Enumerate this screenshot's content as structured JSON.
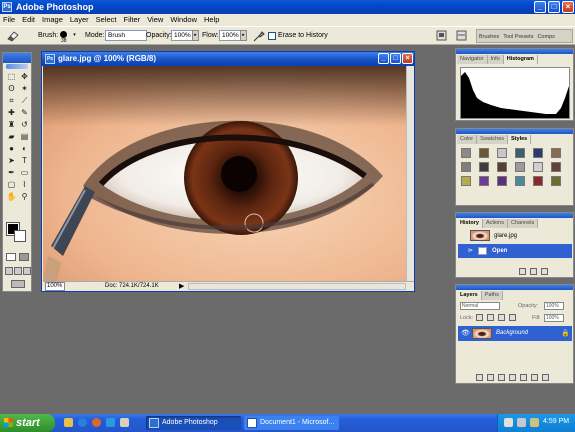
{
  "app": {
    "title": "Adobe Photoshop",
    "logo_text": "Ps"
  },
  "window_controls": {
    "minimize": "_",
    "maximize": "□",
    "close": "×"
  },
  "menu": [
    "File",
    "Edit",
    "Image",
    "Layer",
    "Select",
    "Filter",
    "View",
    "Window",
    "Help"
  ],
  "options_bar": {
    "brush_label": "Brush:",
    "brush_size": "38",
    "mode_label": "Mode:",
    "mode_value": "Brush",
    "opacity_label": "Opacity:",
    "opacity_value": "100%",
    "flow_label": "Flow:",
    "flow_value": "100%",
    "erase_to_history_label": "Erase to History",
    "palette_well_tabs": [
      "Brushes",
      "Tool Presets",
      "Comps"
    ]
  },
  "document": {
    "title": "glare.jpg @ 100% (RGB/8)",
    "zoom": "100%",
    "doc_info": "Doc: 724.1K/724.1K"
  },
  "navigator_palette": {
    "tabs": [
      "Navigator",
      "Info",
      "Histogram"
    ],
    "active_tab": "Histogram"
  },
  "color_palette": {
    "tabs": [
      "Color",
      "Swatches",
      "Styles"
    ],
    "active_tab": "Styles",
    "swatches": [
      "#8a8a8a",
      "#6b5a3a",
      "#c7c7c7",
      "#3b5d6e",
      "#2a3c6d",
      "#8d6a4f",
      "#7f7f7f",
      "#3d3d3d",
      "#5a3f2e",
      "#9b9b9b",
      "#cfcfcf",
      "#66403a",
      "#b3ad4a",
      "#6e3a9a",
      "#5b2f7c",
      "#4a8a9a",
      "#8a2a2a",
      "#6c6c2e"
    ]
  },
  "history_palette": {
    "tabs": [
      "History",
      "Actions",
      "Channels"
    ],
    "active_tab": "History",
    "items": [
      {
        "label": "glare.jpg",
        "type": "snapshot"
      },
      {
        "label": "Open",
        "type": "state",
        "selected": true
      }
    ]
  },
  "layers_palette": {
    "tabs": [
      "Layers",
      "Paths"
    ],
    "active_tab": "Layers",
    "blend_mode": "Normal",
    "opacity_label": "Opacity:",
    "opacity_value": "100%",
    "lock_label": "Lock:",
    "fill_label": "Fill:",
    "fill_value": "100%",
    "layers": [
      {
        "name": "Background",
        "selected": true
      }
    ]
  },
  "taskbar": {
    "start_label": "start",
    "items": [
      {
        "label": "Adobe Photoshop",
        "active": true
      },
      {
        "label": "Document1 - Microsof...",
        "active": false
      }
    ],
    "clock": "4:59 PM"
  },
  "colors": {
    "xp_blue": "#0a46c8",
    "panel_bg": "#ece9d8",
    "selection": "#2f62d0",
    "workspace": "#6b6b6b"
  }
}
